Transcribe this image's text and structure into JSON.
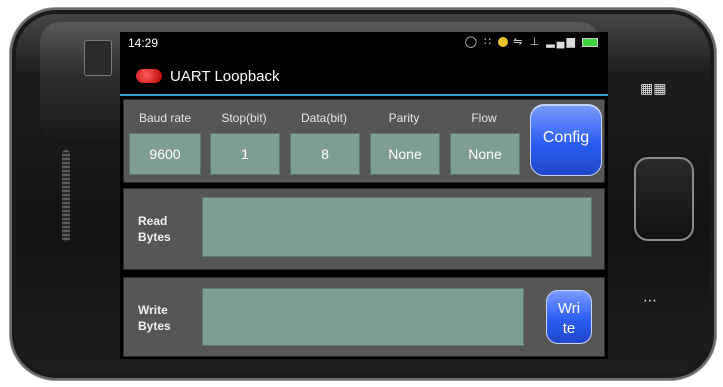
{
  "status_bar": {
    "time": "14:29",
    "icons": [
      "chat-icon",
      "grid-icon",
      "gold-app-icon",
      "usb-icon",
      "network-icon",
      "signal-icon",
      "battery-icon"
    ]
  },
  "app": {
    "title": "UART Loopback"
  },
  "config_panel": {
    "columns": [
      {
        "label": "Baud rate",
        "value": "9600"
      },
      {
        "label": "Stop(bit)",
        "value": "1"
      },
      {
        "label": "Data(bit)",
        "value": "8"
      },
      {
        "label": "Parity",
        "value": "None"
      },
      {
        "label": "Flow",
        "value": "None"
      }
    ],
    "config_button": "Config"
  },
  "read_panel": {
    "label_line1": "Read",
    "label_line2": "Bytes",
    "value": ""
  },
  "write_panel": {
    "label_line1": "Write",
    "label_line2": "Bytes",
    "value": "",
    "write_button_line1": "Wri",
    "write_button_line2": "te"
  },
  "colors": {
    "accent": "#2f9fd0",
    "field": "#7f9e92",
    "panel": "#565656",
    "button_blue": "#2b5df2"
  }
}
